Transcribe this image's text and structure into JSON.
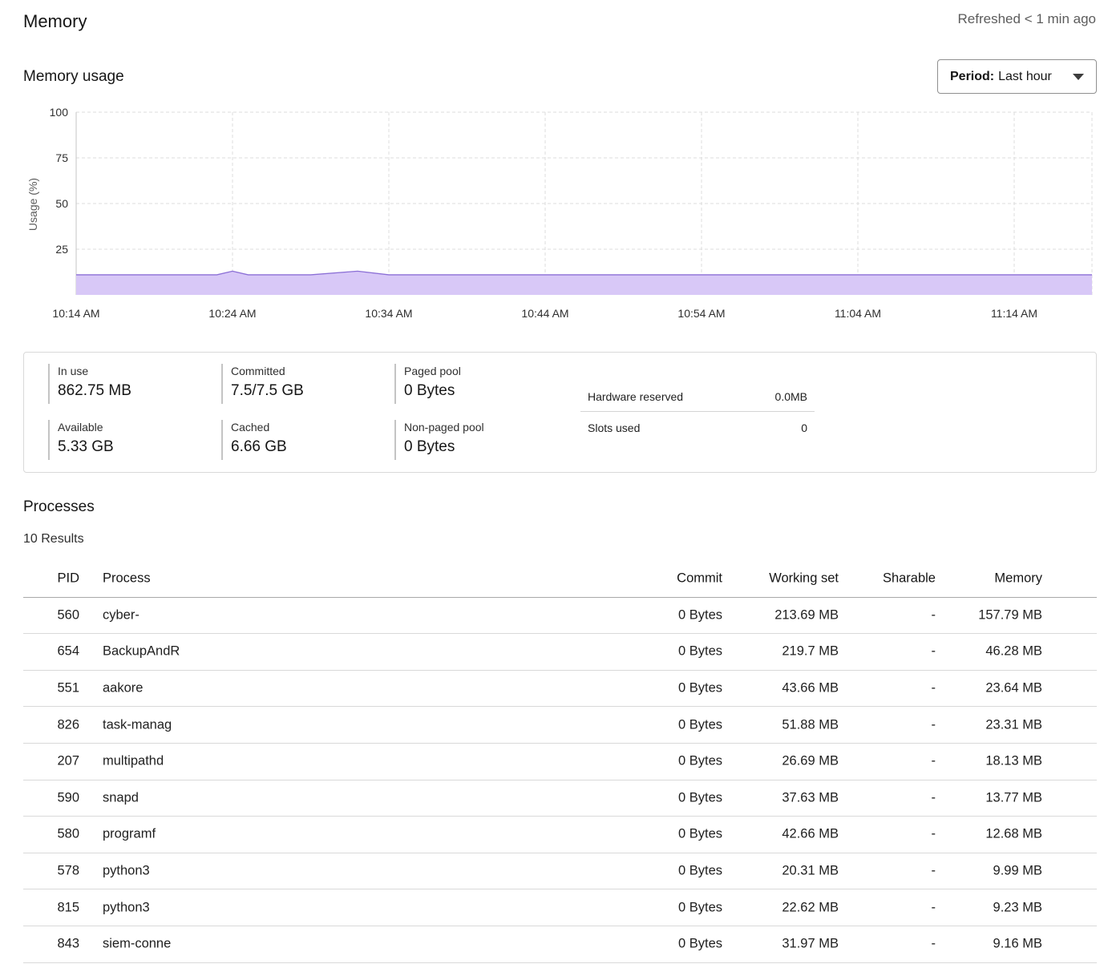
{
  "header": {
    "title": "Memory",
    "refreshed": "Refreshed < 1 min ago"
  },
  "usage_section": {
    "title": "Memory usage",
    "period_key": "Period:",
    "period_value": "Last hour"
  },
  "chart_data": {
    "type": "area",
    "ylabel": "Usage (%)",
    "xlabel": "",
    "ylim": [
      0,
      100
    ],
    "yticks": [
      25,
      50,
      75,
      100
    ],
    "xtick_labels": [
      "10:14 AM",
      "10:24 AM",
      "10:34 AM",
      "10:44 AM",
      "10:54 AM",
      "11:04 AM",
      "11:14 AM"
    ],
    "x_minutes": [
      0,
      9,
      10,
      11,
      13,
      15,
      18,
      20,
      30,
      40,
      50,
      60,
      65
    ],
    "values": [
      11,
      11,
      13,
      11,
      11,
      11,
      13,
      11,
      11,
      11,
      11,
      11,
      11
    ],
    "grid": true,
    "colors": {
      "fill": "#d8c8f7",
      "line": "#8b6fd6",
      "grid": "#dcdcdc"
    }
  },
  "stats": {
    "in_use": {
      "label": "In use",
      "value": "862.75 MB"
    },
    "available": {
      "label": "Available",
      "value": "5.33 GB"
    },
    "committed": {
      "label": "Committed",
      "value": "7.5/7.5 GB"
    },
    "cached": {
      "label": "Cached",
      "value": "6.66 GB"
    },
    "paged_pool": {
      "label": "Paged pool",
      "value": "0 Bytes"
    },
    "non_paged_pool": {
      "label": "Non-paged pool",
      "value": "0 Bytes"
    },
    "hardware_reserved": {
      "label": "Hardware reserved",
      "value": "0.0MB"
    },
    "slots_used": {
      "label": "Slots used",
      "value": "0"
    }
  },
  "processes": {
    "title": "Processes",
    "results": "10 Results",
    "columns": {
      "pid": "PID",
      "process": "Process",
      "commit": "Commit",
      "working_set": "Working set",
      "sharable": "Sharable",
      "memory": "Memory"
    },
    "rows": [
      {
        "pid": "560",
        "process": "cyber-",
        "commit": "0 Bytes",
        "working_set": "213.69 MB",
        "sharable": "-",
        "memory": "157.79 MB"
      },
      {
        "pid": "654",
        "process": "BackupAndR",
        "commit": "0 Bytes",
        "working_set": "219.7 MB",
        "sharable": "-",
        "memory": "46.28 MB"
      },
      {
        "pid": "551",
        "process": "aakore",
        "commit": "0 Bytes",
        "working_set": "43.66 MB",
        "sharable": "-",
        "memory": "23.64 MB"
      },
      {
        "pid": "826",
        "process": "task-manag",
        "commit": "0 Bytes",
        "working_set": "51.88 MB",
        "sharable": "-",
        "memory": "23.31 MB"
      },
      {
        "pid": "207",
        "process": "multipathd",
        "commit": "0 Bytes",
        "working_set": "26.69 MB",
        "sharable": "-",
        "memory": "18.13 MB"
      },
      {
        "pid": "590",
        "process": "snapd",
        "commit": "0 Bytes",
        "working_set": "37.63 MB",
        "sharable": "-",
        "memory": "13.77 MB"
      },
      {
        "pid": "580",
        "process": "programf",
        "commit": "0 Bytes",
        "working_set": "42.66 MB",
        "sharable": "-",
        "memory": "12.68 MB"
      },
      {
        "pid": "578",
        "process": "python3",
        "commit": "0 Bytes",
        "working_set": "20.31 MB",
        "sharable": "-",
        "memory": "9.99 MB"
      },
      {
        "pid": "815",
        "process": "python3",
        "commit": "0 Bytes",
        "working_set": "22.62 MB",
        "sharable": "-",
        "memory": "9.23 MB"
      },
      {
        "pid": "843",
        "process": "siem-conne",
        "commit": "0 Bytes",
        "working_set": "31.97 MB",
        "sharable": "-",
        "memory": "9.16 MB"
      }
    ]
  }
}
